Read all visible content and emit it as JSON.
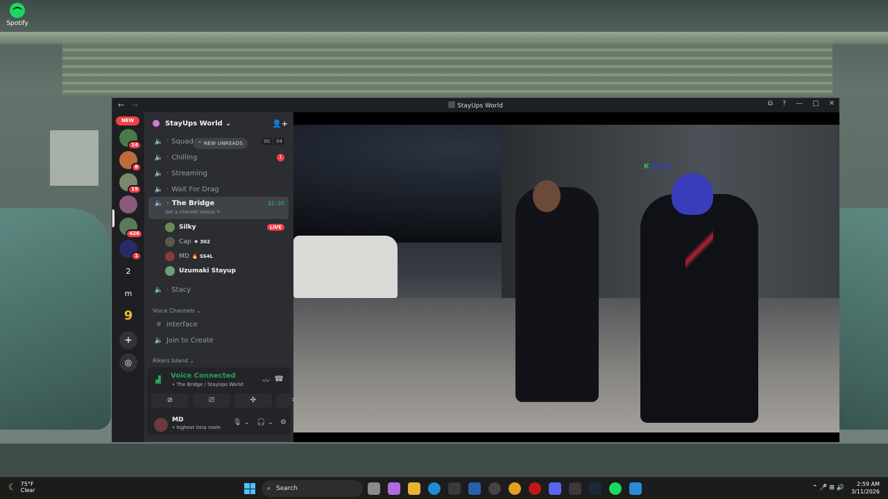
{
  "desktop": {
    "icon_label": "Spotify"
  },
  "window": {
    "title": "StayUps World",
    "nav_back": "←",
    "nav_forward": "→",
    "controls": {
      "inbox": "⧉",
      "help": "?",
      "minimize": "—",
      "maximize": "□",
      "close": "✕"
    }
  },
  "servers": {
    "new_label": "NEW",
    "items": [
      {
        "badge": "14",
        "color": "#4a7a4a"
      },
      {
        "badge": "8",
        "color": "#c26a3a"
      },
      {
        "badge": "19",
        "color": "#7a8a6a"
      },
      {
        "badge": "",
        "color": "#8a5a7a"
      },
      {
        "badge": "426",
        "color": "#5a7a5a"
      },
      {
        "badge": "1",
        "color": "#2a2a6a"
      },
      {
        "label": "2",
        "color": "#1e1f22"
      },
      {
        "label": "m",
        "color": "#1e1f22"
      },
      {
        "label": "9",
        "color": "#1e1f22"
      },
      {
        "label": "+",
        "color": "#313338"
      },
      {
        "label": "◎",
        "color": "#313338"
      }
    ]
  },
  "server": {
    "name": "StayUps World",
    "chevron": "⌄",
    "invite_icon": "👤+"
  },
  "channels": {
    "new_unreads": "⌃ NEW UNREADS",
    "squad": {
      "name": "Squad",
      "count_a": "00",
      "count_b": "04"
    },
    "chilling": {
      "name": "Chilling",
      "unread": "1"
    },
    "streaming": {
      "name": "Streaming"
    },
    "wait_for_drag": {
      "name": "Wait For Drag"
    },
    "the_bridge": {
      "name": "The Bridge",
      "timer": "32:35",
      "status": "Set a channel status ✎"
    },
    "stacy": {
      "name": "Stacy"
    },
    "voice_category": "Voice Channels ⌄",
    "interface": {
      "name": "interface"
    },
    "join_to_create": {
      "name": "Join to Create"
    },
    "rikers_category": "Rikers Island ⌄"
  },
  "voice_users": [
    {
      "name": "Silky",
      "live": "LIVE",
      "avatar_color": "#6a8a5a",
      "tag": ""
    },
    {
      "name": "Cap",
      "tag": "❖ 302",
      "avatar_color": "#5a5a4a",
      "live": ""
    },
    {
      "name": "MD",
      "tag": "🔥 SS4L",
      "avatar_color": "#8a3a3a",
      "live": ""
    },
    {
      "name": "Uzumaki Stayup",
      "tag": "",
      "avatar_color": "#6aa07a",
      "live": ""
    }
  ],
  "voice_panel": {
    "title": "Voice Connected",
    "subtitle": "• The Bridge / StayUps World",
    "btn_camera": "⊘",
    "btn_screen": "⎚",
    "btn_activities": "✣",
    "btn_soundboard": "✲",
    "hangup": "☎",
    "noise": "〰"
  },
  "me": {
    "name": "MD",
    "status": "• highest inna room",
    "mic": "🎙 ⌄",
    "headset": "🎧 ⌄",
    "settings": "⚙"
  },
  "stream": {
    "overlay_logo_k": "K",
    "overlay_logo_rest": "lilcan"
  },
  "taskbar": {
    "weather_temp": "75°F",
    "weather_desc": "Clear",
    "search_placeholder": "Search",
    "time": "2:59 AM",
    "date": "3/11/2026",
    "tray": "⌃  🎤  ⊞  🔊"
  }
}
